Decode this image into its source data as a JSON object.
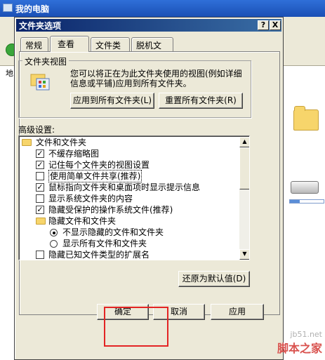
{
  "background_window": {
    "title": "我的电脑",
    "address_label": "地"
  },
  "dialog": {
    "title": "文件夹选项",
    "help_glyph": "?",
    "close_glyph": "X",
    "tabs": [
      {
        "label": "常规"
      },
      {
        "label": "查看"
      },
      {
        "label": "文件类型"
      },
      {
        "label": "脱机文件"
      }
    ],
    "active_tab": "查看",
    "folder_views": {
      "group_title": "文件夹视图",
      "description": "您可以将正在为此文件夹使用的视图(例如详细信息或平铺)应用到所有文件夹。",
      "apply_all_label": "应用到所有文件夹(L)",
      "reset_all_label": "重置所有文件夹(R)"
    },
    "advanced": {
      "label": "高级设置:",
      "items": [
        {
          "type": "folder",
          "text": "文件和文件夹",
          "indent": 0
        },
        {
          "type": "checkbox",
          "checked": true,
          "text": "不缓存缩略图",
          "indent": 1
        },
        {
          "type": "checkbox",
          "checked": true,
          "text": "记住每个文件夹的视图设置",
          "indent": 1
        },
        {
          "type": "checkbox",
          "checked": false,
          "text": "使用简单文件共享(推荐)",
          "indent": 1,
          "focused": true
        },
        {
          "type": "checkbox",
          "checked": true,
          "text": "鼠标指向文件夹和桌面项时显示提示信息",
          "indent": 1
        },
        {
          "type": "checkbox",
          "checked": false,
          "text": "显示系统文件夹的内容",
          "indent": 1
        },
        {
          "type": "checkbox",
          "checked": true,
          "text": "隐藏受保护的操作系统文件(推荐)",
          "indent": 1
        },
        {
          "type": "folder",
          "text": "隐藏文件和文件夹",
          "indent": 1
        },
        {
          "type": "radio",
          "selected": true,
          "text": "不显示隐藏的文件和文件夹",
          "indent": 2
        },
        {
          "type": "radio",
          "selected": false,
          "text": "显示所有文件和文件夹",
          "indent": 2
        },
        {
          "type": "checkbox",
          "checked": false,
          "text": "隐藏已知文件类型的扩展名",
          "indent": 1
        }
      ],
      "restore_defaults_label": "还原为默认值(D)"
    },
    "buttons": {
      "ok": "确定",
      "cancel": "取消",
      "apply": "应用"
    }
  },
  "watermark": {
    "url": "jb51.net",
    "name": "脚本之家"
  },
  "colors": {
    "highlight_box": "#e32424",
    "title_gradient_start": "#0a246a",
    "dialog_face": "#ece9d8"
  }
}
